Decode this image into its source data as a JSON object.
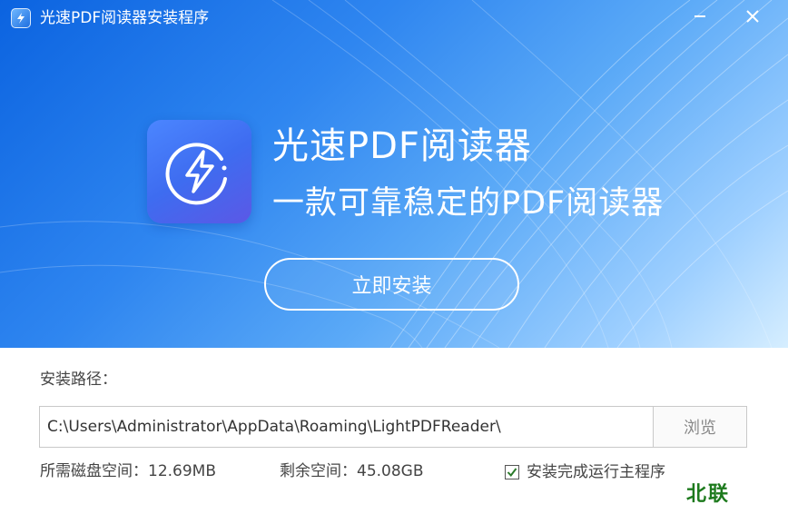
{
  "window": {
    "title": "光速PDF阅读器安装程序",
    "minimize_icon": "minimize-icon",
    "close_icon": "close-icon"
  },
  "hero": {
    "app_icon": "lightning-bolt-icon",
    "title": "光速PDF阅读器",
    "subtitle": "一款可靠稳定的PDF阅读器",
    "install_button": "立即安装",
    "colors": {
      "gradient_start": "#0b63e0",
      "gradient_end": "#d6eeff",
      "logo": "#4b86ff"
    }
  },
  "install": {
    "path_label": "安装路径：",
    "path_value": "C:\\Users\\Administrator\\AppData\\Roaming\\LightPDFReader\\",
    "browse_button": "浏览",
    "required_space": "所需磁盘空间：12.69MB",
    "free_space": "剩余空间：45.08GB",
    "run_after_install": {
      "label": "安装完成运行主程序",
      "checked": true
    }
  },
  "watermark": "北联"
}
